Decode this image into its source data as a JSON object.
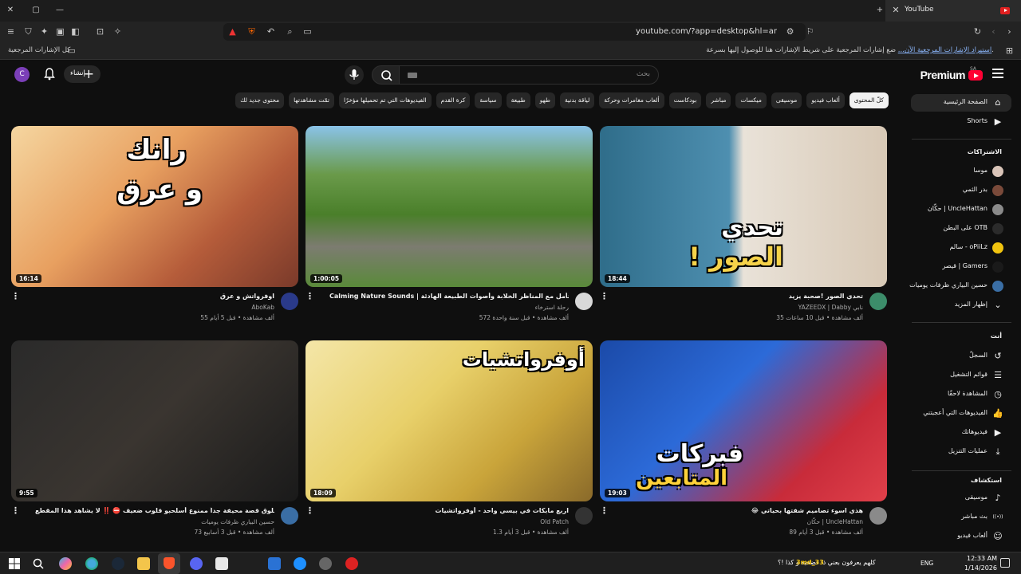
{
  "browser": {
    "tab_title": "YouTube",
    "url": "youtube.com/?app=desktop&hl=ar",
    "bookmarks_prompt": "ضع إشارات المرجعية على شريط الإشارات هنا للوصول إليها بسرعة.",
    "bookmarks_import": "استيراد الإشارات المرجعية الآن...",
    "all_bookmarks": "كل الإشارات المرجعية"
  },
  "header": {
    "logo_text": "Premium",
    "logo_sup": "SA",
    "search_placeholder": "بحث",
    "create_label": "إنشاء",
    "avatar_letter": "C"
  },
  "chips": [
    {
      "label": "كلّ المحتوى",
      "active": true
    },
    {
      "label": "ألعاب فيديو"
    },
    {
      "label": "موسيقى"
    },
    {
      "label": "ميكسات"
    },
    {
      "label": "مباشر"
    },
    {
      "label": "بودكاست"
    },
    {
      "label": "ألعاب مغامرات وحركة"
    },
    {
      "label": "لياقة بدنية"
    },
    {
      "label": "طهو"
    },
    {
      "label": "طبيعة"
    },
    {
      "label": "سياسة"
    },
    {
      "label": "كرة القدم"
    },
    {
      "label": "الفيديوهات التي تم تحميلها مؤخرًا"
    },
    {
      "label": "تمّت مشاهدتها"
    },
    {
      "label": "محتوى جديد لك"
    }
  ],
  "sidebar": {
    "main": [
      {
        "label": "الصفحة الرئيسية",
        "icon": "home-icon",
        "active": true
      },
      {
        "label": "Shorts",
        "icon": "shorts-icon"
      }
    ],
    "subscriptions_heading": "الاشتراكات",
    "subscriptions": [
      {
        "label": "موسا",
        "color": "#d9c4b8"
      },
      {
        "label": "بدر الثمي",
        "color": "#7a4a3a"
      },
      {
        "label": "حكّان | UncleHattan",
        "color": "#8a8a8a"
      },
      {
        "label": "على البطن OTB",
        "color": "#2b2b2b"
      },
      {
        "label": "سالم - oPiiLz",
        "color": "#f1c40f"
      },
      {
        "label": "قيصر | Gamers",
        "color": "#1a1a1a"
      },
      {
        "label": "حسين البياري ظرفات يوميات",
        "color": "#3a6ea5"
      }
    ],
    "show_more": "إظهار المزيد",
    "you_heading": "أنت",
    "you": [
      {
        "label": "السجلّ",
        "icon": "history-icon"
      },
      {
        "label": "قوائم التشغيل",
        "icon": "playlist-icon"
      },
      {
        "label": "المشاهدة لاحقًا",
        "icon": "watch-later-icon"
      },
      {
        "label": "الفيديوهات التي أعجبتني",
        "icon": "like-icon"
      },
      {
        "label": "فيديوهاتك",
        "icon": "your-videos-icon"
      },
      {
        "label": "عمليات التنزيل",
        "icon": "download-icon"
      }
    ],
    "explore_heading": "استكشاف",
    "explore": [
      {
        "label": "موسيقى",
        "icon": "music-icon"
      },
      {
        "label": "بث مباشر",
        "icon": "live-icon"
      },
      {
        "label": "ألعاب فيديو",
        "icon": "gaming-icon"
      }
    ]
  },
  "videos": [
    {
      "title": "تحدي الصور !صحبة يزيد",
      "channel": "YAZEEDX | Dabby نابي",
      "meta": "35 ألف مشاهدة • قبل 10 ساعات",
      "duration": "18:44",
      "thumb_text_1": "تحدي",
      "thumb_text_2": "الصور !",
      "avatar_color": "#3c8d6a"
    },
    {
      "title": "Calming Nature Sounds | استرخاء وتأمل مع المناظر الخلابة وأصوات الطبيعة الهادئة",
      "channel": "رحلة استرخاء",
      "meta": "572 ألف مشاهدة • قبل سنة واحدة",
      "duration": "1:00:05",
      "avatar_color": "#d8d8d8"
    },
    {
      "title": "اوفرواتش و عرق",
      "channel": "AboKab",
      "meta": "55 ألف مشاهدة • قبل 5 أيام",
      "duration": "16:14",
      "thumb_text_1": "رانك",
      "thumb_text_2": "و عرق",
      "avatar_color": "#2a3a8a"
    },
    {
      "title": "😂 هذي اسوء تصاميم شفتها بحياتي",
      "channel": "حكّان | UncleHattan",
      "meta": "89 ألف مشاهدة • قبل 3 أيام",
      "duration": "19:03",
      "thumb_text_1": "فبركات",
      "thumb_text_2": "المتابعين",
      "avatar_color": "#8a8a8a"
    },
    {
      "title": "اربع مابكات في بيسي واحد - أوفرواتشيات",
      "channel": "Old Patch",
      "meta": "1.3 ألف مشاهدة • قبل 3 أيام",
      "duration": "18:09",
      "thumb_text_1": "أوفرواتشيات",
      "avatar_color": "#333333"
    },
    {
      "title": "فلوق قصة محيفة جداً ممنوع أسلحبو قلوب ضعيف ⛔ ‼️ لا يشاهد هذا المقطع",
      "channel": "حسين البياري ظرفات يوميات",
      "meta": "73 ألف مشاهدة • قبل 3 أسابيع",
      "duration": "9:55",
      "avatar_color": "#3a6ea5"
    }
  ],
  "taskbar": {
    "time": "12:33 AM",
    "date": "1/14/2026",
    "lang": "ENG",
    "news_handle": "3md_33",
    "news_text": "كلهم يعرفون بعني ذا فضحيه و كذا !؟"
  }
}
